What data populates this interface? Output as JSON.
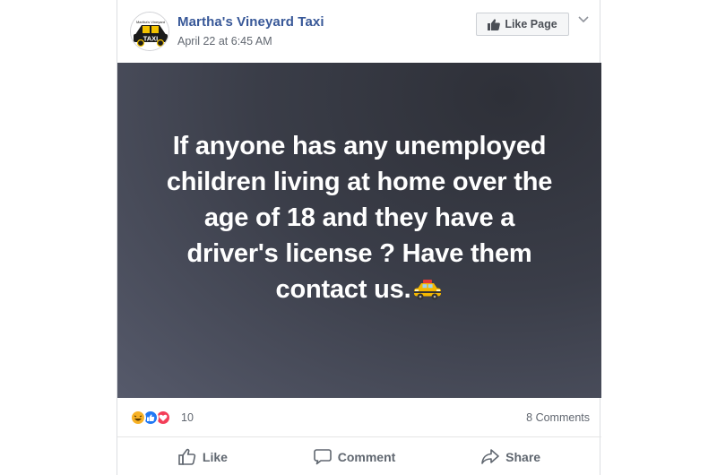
{
  "post": {
    "page_name": "Martha's Vineyard Taxi",
    "timestamp": "April 22 at 6:45 AM",
    "avatar_text_top": "Martha's Vineyard",
    "avatar_text_main": "TAXI",
    "like_page_label": "Like Page",
    "body_lines": [
      "If anyone has any unemployed",
      "children living at home over the",
      "age of 18 and they have a",
      "driver's license ? Have them",
      "contact us."
    ],
    "body_emoji": "taxi-emoji"
  },
  "reactions": {
    "count": "10",
    "types": [
      "haha",
      "like",
      "love"
    ],
    "colors": {
      "haha": "#f7b125",
      "like": "#2078f4",
      "love": "#f33e58"
    },
    "comments_label": "8 Comments"
  },
  "actions": {
    "like_label": "Like",
    "comment_label": "Comment",
    "share_label": "Share"
  },
  "colors": {
    "link_blue": "#385898",
    "text_gray": "#616770",
    "action_gray": "#606770"
  }
}
